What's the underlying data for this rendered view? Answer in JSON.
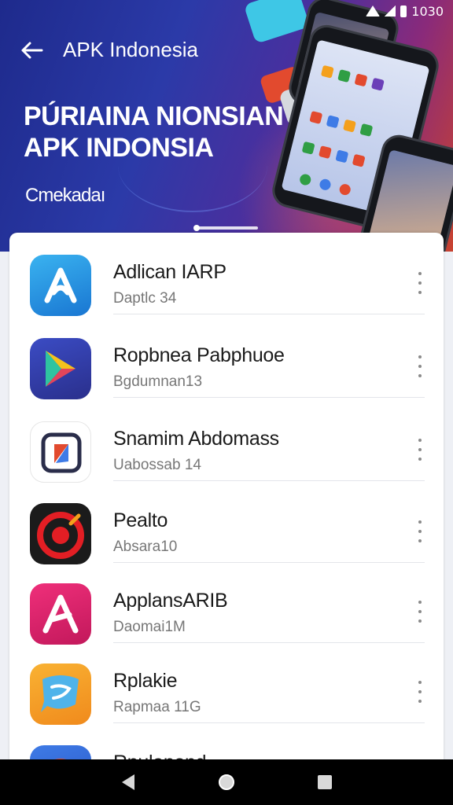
{
  "status_bar": {
    "time": "1030"
  },
  "header": {
    "title": "APK Indonesia",
    "headline_line1": "PÚRIAINA NIONSIAN",
    "headline_line2": "APK INDONSIA",
    "subtitle": "Cmekadaı"
  },
  "apps": [
    {
      "name": "Adlican IARP",
      "sub": "Daptlc 34",
      "icon": "blue-a-icon"
    },
    {
      "name": "Ropbnea Pabphuoe",
      "sub": "Bgdumnan13",
      "icon": "play-triangle-icon"
    },
    {
      "name": "Snamim Abdomass",
      "sub": "Uabossab 14",
      "icon": "square-logo-icon"
    },
    {
      "name": "Pealto",
      "sub": "Absara10",
      "icon": "target-ring-icon"
    },
    {
      "name": "ApplansARIB",
      "sub": "Daomai1M",
      "icon": "pink-a-icon"
    },
    {
      "name": "Rplakie",
      "sub": "Rapmaa 11G",
      "icon": "chat-bubble-icon"
    },
    {
      "name": "Rpulapond",
      "sub": "",
      "icon": "red-round-icon"
    }
  ],
  "colors": {
    "banner_start": "#1e2a8c",
    "banner_end": "#c9432f",
    "card_bg": "#ffffff",
    "nav_bg": "#000000"
  },
  "nav": {
    "back": "back-triangle-icon",
    "home": "home-circle-icon",
    "recents": "recents-square-icon"
  }
}
